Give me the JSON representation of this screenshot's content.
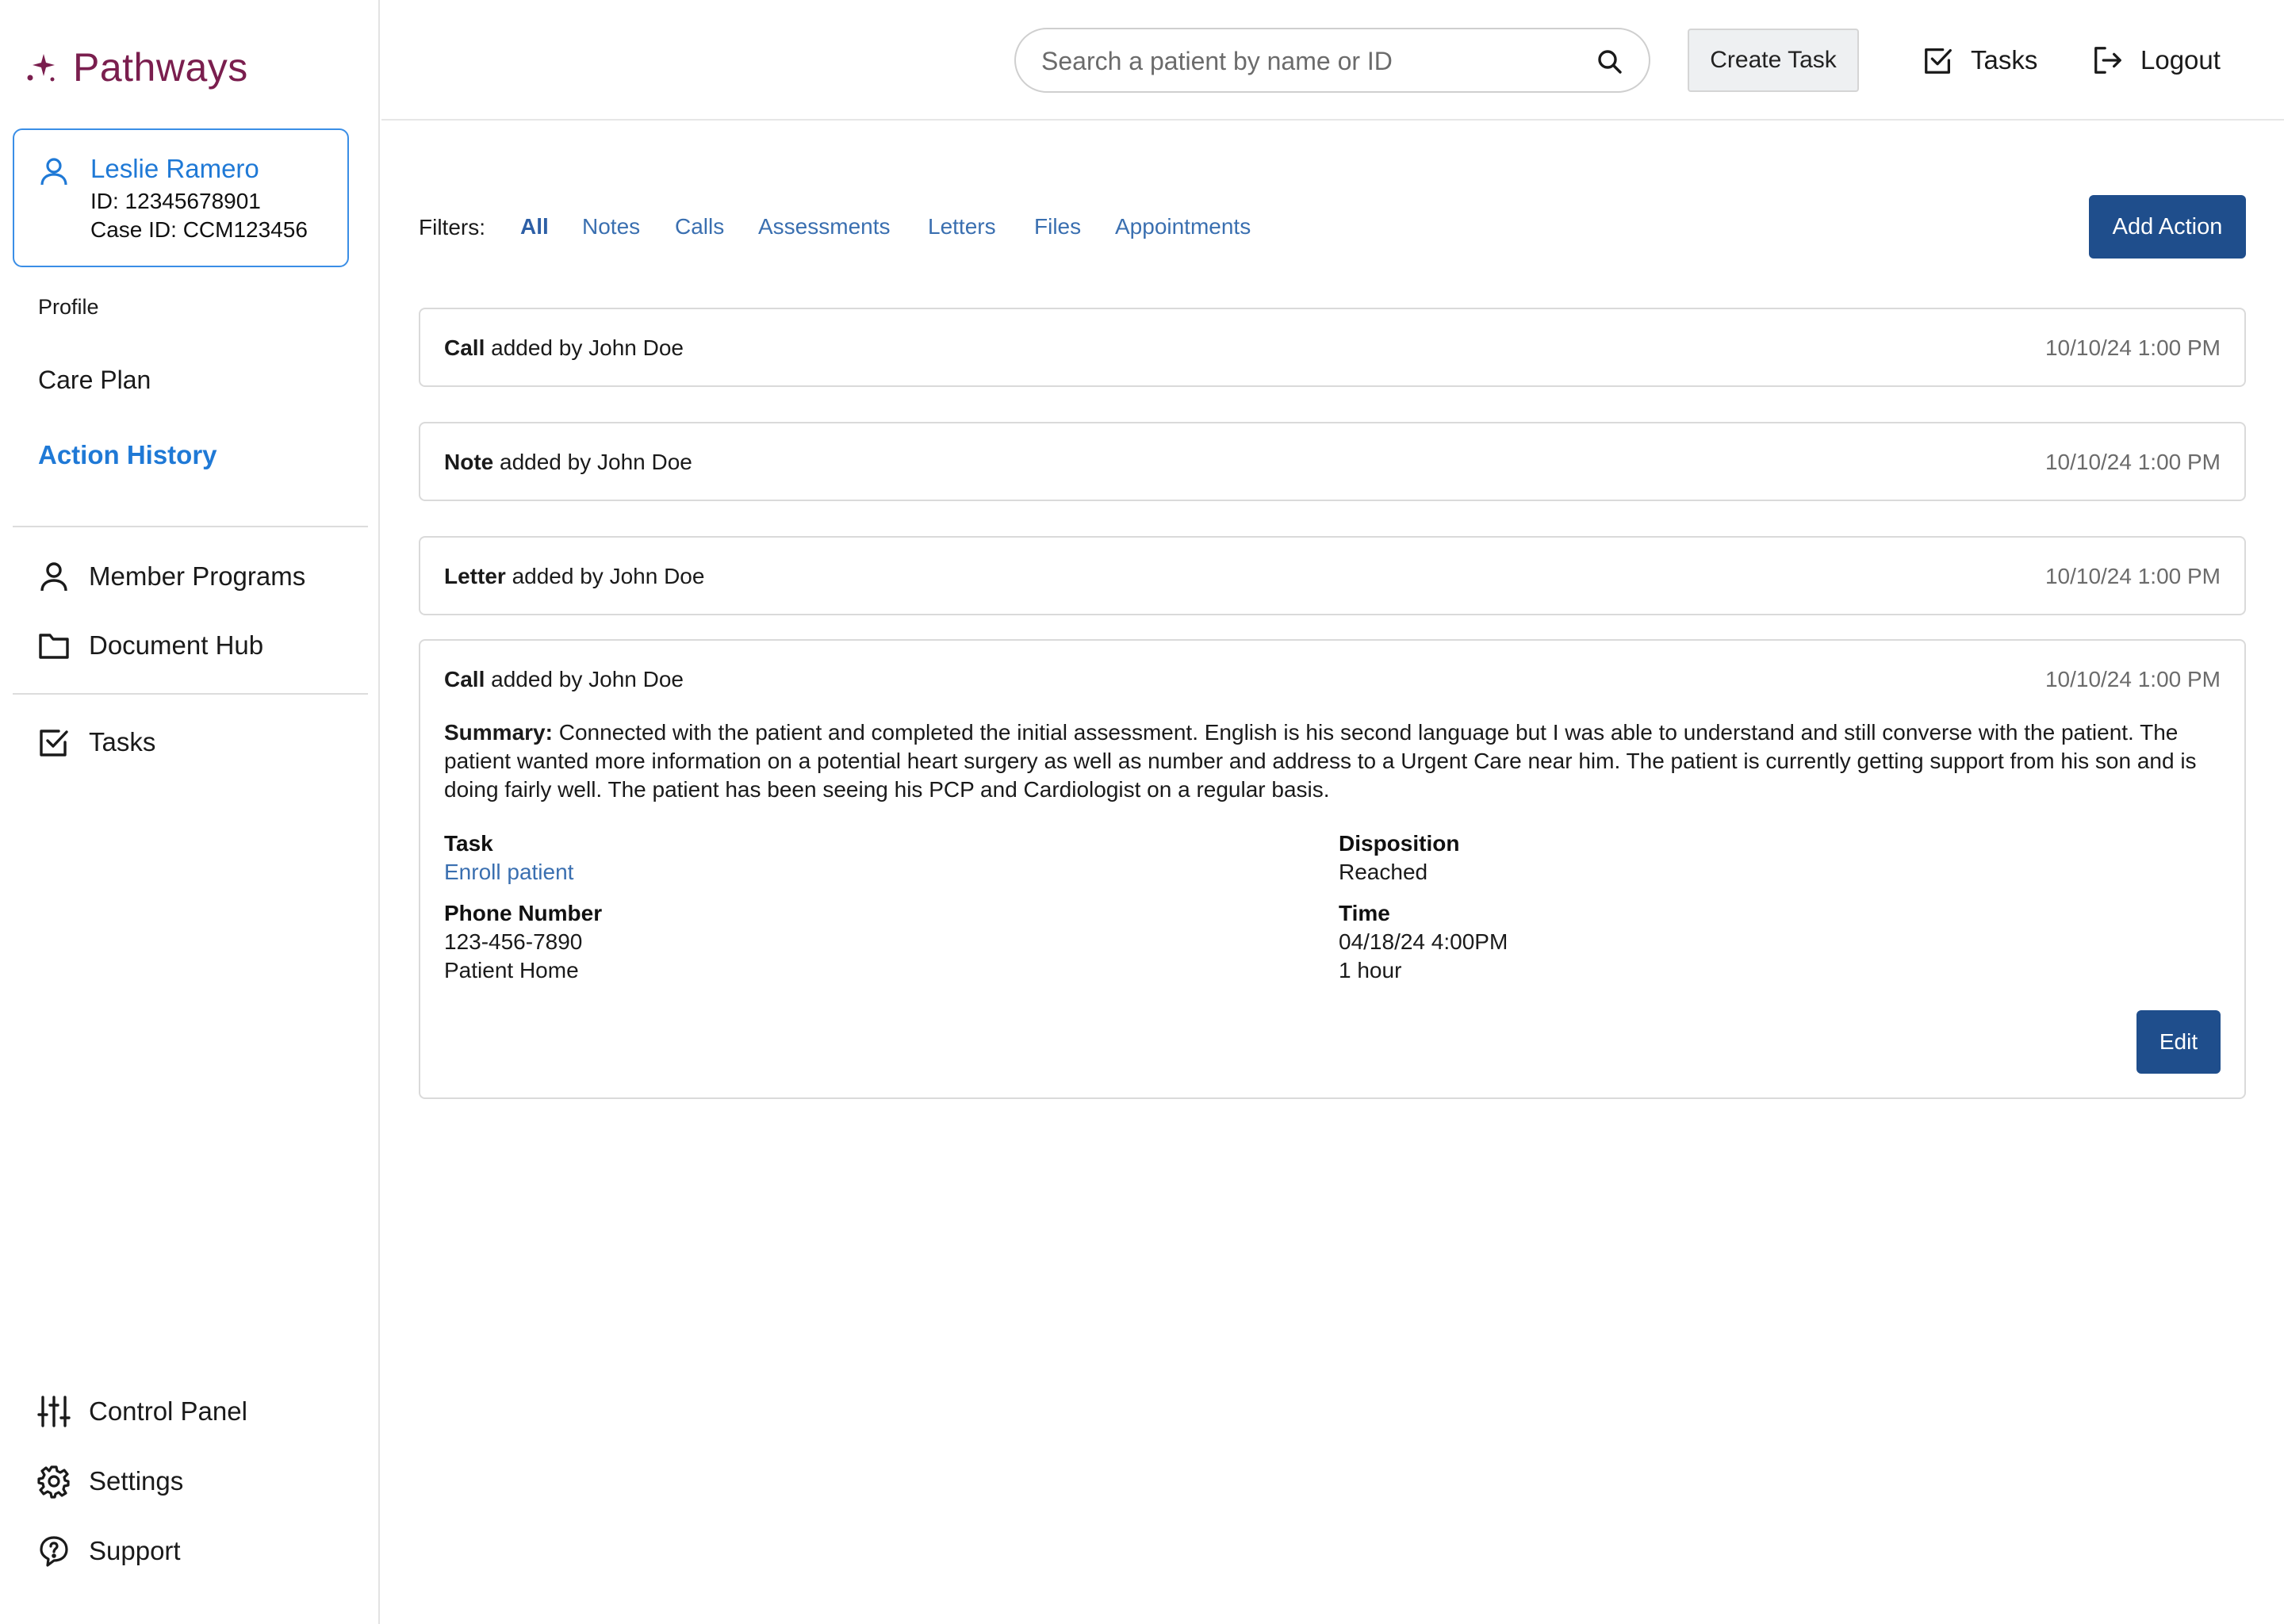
{
  "app": {
    "name": "Pathways",
    "brand_color": "#7a1e4e"
  },
  "patient": {
    "name": "Leslie Ramero",
    "id_text": "ID: 12345678901",
    "case_text": "Case ID: CCM123456"
  },
  "sidebar": {
    "sub_items": [
      {
        "label": "Profile"
      },
      {
        "label": "Care Plan"
      },
      {
        "label": "Action History"
      }
    ],
    "nav_items": [
      {
        "label": "Member Programs",
        "icon": "person-icon"
      },
      {
        "label": "Document Hub",
        "icon": "folder-icon"
      },
      {
        "label": "Tasks",
        "icon": "checkbox-icon"
      }
    ],
    "bottom_items": [
      {
        "label": "Control Panel",
        "icon": "sliders-icon"
      },
      {
        "label": "Settings",
        "icon": "gear-icon"
      },
      {
        "label": "Support",
        "icon": "help-icon"
      }
    ]
  },
  "topbar": {
    "search_placeholder": "Search a patient by name or ID",
    "create_task": "Create Task",
    "tasks": "Tasks",
    "logout": "Logout"
  },
  "filters": {
    "label": "Filters:",
    "options": [
      "All",
      "Notes",
      "Calls",
      "Assessments",
      "Letters",
      "Files",
      "Appointments"
    ],
    "active": "All",
    "add_action": "Add Action"
  },
  "actions": [
    {
      "type": "Call",
      "suffix": "added by John Doe",
      "time": "10/10/24 1:00 PM"
    },
    {
      "type": "Note",
      "suffix": "added by John Doe",
      "time": "10/10/24 1:00 PM"
    },
    {
      "type": "Letter",
      "suffix": "added by John Doe",
      "time": "10/10/24 1:00 PM"
    },
    {
      "type": "Call",
      "suffix": "added by John Doe",
      "time": "10/10/24 1:00 PM",
      "summary_label": "Summary:",
      "summary": "Connected with the patient and completed the initial assessment. English is his second language but I was able to understand and still converse with the patient. The patient wanted more information on a potential heart surgery as well as number and address to a Urgent Care near him. The patient is currently getting support from his son and is doing fairly well. The patient has been seeing his PCP and Cardiologist on a regular basis.",
      "task_label": "Task",
      "task_value": "Enroll patient",
      "disposition_label": "Disposition",
      "disposition_value": "Reached",
      "phone_label": "Phone Number",
      "phone_value": "123-456-7890",
      "phone_type": "Patient Home",
      "time_label": "Time",
      "time_value": "04/18/24 4:00PM",
      "duration": "1 hour",
      "edit": "Edit"
    }
  ]
}
